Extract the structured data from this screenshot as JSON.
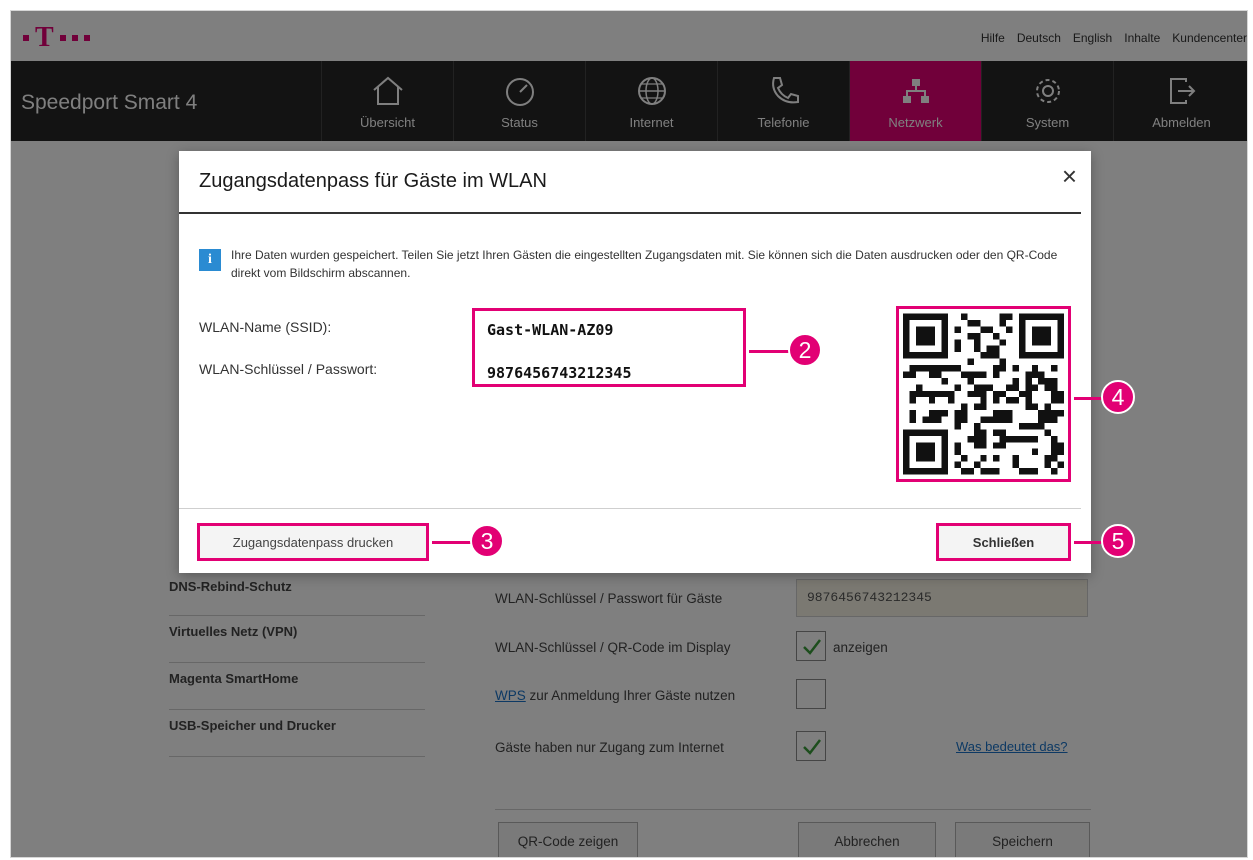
{
  "topbar": {
    "links": [
      "Hilfe",
      "Deutsch",
      "English",
      "Inhalte",
      "Kundencenter"
    ]
  },
  "navbar": {
    "brand": "Speedport Smart 4",
    "items": [
      {
        "label": "Übersicht",
        "icon": "home-icon"
      },
      {
        "label": "Status",
        "icon": "gauge-icon"
      },
      {
        "label": "Internet",
        "icon": "globe-icon"
      },
      {
        "label": "Telefonie",
        "icon": "phone-icon"
      },
      {
        "label": "Netzwerk",
        "icon": "network-icon",
        "active": true
      },
      {
        "label": "System",
        "icon": "gear-icon"
      },
      {
        "label": "Abmelden",
        "icon": "logout-icon"
      }
    ],
    "active_color": "#e20074"
  },
  "sidebar": {
    "items": [
      "DNS-Rebind-Schutz",
      "Virtuelles Netz (VPN)",
      "Magenta SmartHome",
      "USB-Speicher und Drucker"
    ]
  },
  "form": {
    "guest_key_label": "WLAN-Schlüssel / Passwort für Gäste",
    "guest_key_value": "9876456743212345",
    "display_label": "WLAN-Schlüssel / QR-Code im Display",
    "display_option": "anzeigen",
    "display_checked": true,
    "wps_link": "WPS",
    "wps_label": " zur Anmeldung Ihrer Gäste nutzen",
    "wps_checked": false,
    "internet_only_label": "Gäste haben nur Zugang zum Internet",
    "internet_only_checked": true,
    "info_link": "Was bedeutet das?",
    "qr_button": "QR-Code zeigen",
    "cancel_button": "Abbrechen",
    "save_button": "Speichern"
  },
  "modal": {
    "title": "Zugangsdatenpass für Gäste im WLAN",
    "close_symbol": "×",
    "info_text": "Ihre Daten wurden gespeichert. Teilen Sie jetzt Ihren Gästen die eingestellten Zugangsdaten mit. Sie können sich die Daten ausdrucken oder den QR-Code direkt vom Bildschirm abscannen.",
    "ssid_label": "WLAN-Name (SSID):",
    "ssid_value": "Gast-WLAN-AZ09",
    "password_label": "WLAN-Schlüssel / Passwort:",
    "password_value": "9876456743212345",
    "print_button": "Zugangsdatenpass drucken",
    "close_button": "Schließen"
  },
  "callouts": [
    "2",
    "3",
    "4",
    "5"
  ],
  "accent_color": "#e20074"
}
